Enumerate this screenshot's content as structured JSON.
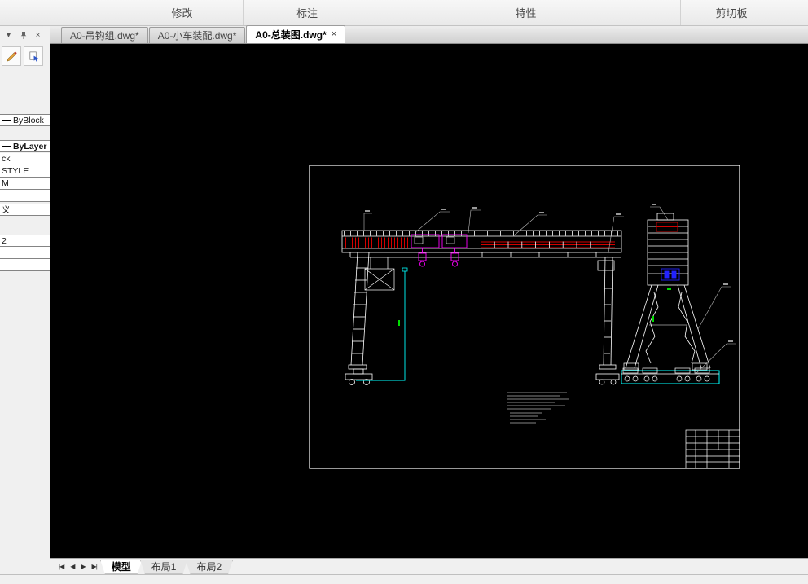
{
  "ribbon": {
    "panels": [
      {
        "label": "修改"
      },
      {
        "label": "标注"
      },
      {
        "label": "特性"
      },
      {
        "label": "剪切板"
      }
    ]
  },
  "doc_tabs": {
    "items": [
      {
        "label": "A0-吊钩组.dwg*"
      },
      {
        "label": "A0-小车装配.dwg*"
      },
      {
        "label": "A0-总装图.dwg*"
      }
    ],
    "close_glyph": "×"
  },
  "palette": {
    "chevron_glyph": "▾",
    "close_glyph": "×"
  },
  "sidebar": {
    "rows": [
      {
        "label": "ByBlock"
      },
      {
        "label": "ByLayer"
      },
      {
        "label": "ck"
      },
      {
        "label": "STYLE"
      },
      {
        "label": "M"
      },
      {
        "label": "义"
      },
      {
        "label": "2"
      }
    ]
  },
  "layout_tabs": {
    "nav": [
      "|◀",
      "◀",
      "▶",
      "▶|"
    ],
    "items": [
      {
        "label": "模型"
      },
      {
        "label": "布局1"
      },
      {
        "label": "布局2"
      }
    ]
  },
  "colors": {
    "canvas_bg": "#000000",
    "line_white": "#ffffff",
    "accent_red": "#dd0000",
    "accent_magenta": "#ff00ff",
    "accent_cyan": "#00ffff",
    "accent_blue": "#2222ff",
    "accent_green": "#00dd00"
  }
}
